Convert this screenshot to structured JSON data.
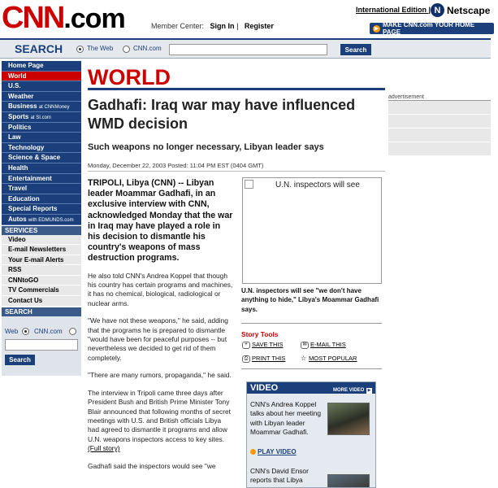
{
  "header": {
    "logo_main": "CNN",
    "logo_suffix": ".com",
    "member_label": "Member Center:",
    "sign_in": "Sign In",
    "sep": "|",
    "register": "Register",
    "international": "International Edition",
    "intl_sep": "|",
    "netscape": "Netscape",
    "netscape_icon": "N",
    "make_home": "MAKE CNN.com YOUR HOME PAGE"
  },
  "searchbar": {
    "title": "SEARCH",
    "option_web": "The Web",
    "option_cnn": "CNN.com",
    "input_value": "",
    "button": "Search"
  },
  "nav": {
    "items": [
      {
        "label": "Home Page",
        "sub": ""
      },
      {
        "label": "World",
        "sub": ""
      },
      {
        "label": "U.S.",
        "sub": ""
      },
      {
        "label": "Weather",
        "sub": ""
      },
      {
        "label": "Business",
        "sub": "at CNNMoney"
      },
      {
        "label": "Sports",
        "sub": "at SI.com"
      },
      {
        "label": "Politics",
        "sub": ""
      },
      {
        "label": "Law",
        "sub": ""
      },
      {
        "label": "Technology",
        "sub": ""
      },
      {
        "label": "Science & Space",
        "sub": ""
      },
      {
        "label": "Health",
        "sub": ""
      },
      {
        "label": "Entertainment",
        "sub": ""
      },
      {
        "label": "Travel",
        "sub": ""
      },
      {
        "label": "Education",
        "sub": ""
      },
      {
        "label": "Special Reports",
        "sub": ""
      },
      {
        "label": "Autos",
        "sub": "with EDMUNDS.com"
      }
    ],
    "services_title": "SERVICES",
    "services": [
      "Video",
      "E-mail Newsletters",
      "Your E-mail Alerts",
      "RSS",
      "CNNtoGO",
      "TV Commercials",
      "Contact Us"
    ],
    "search_title": "SEARCH",
    "search_web": "Web",
    "search_cnn": "CNN.com",
    "search_button": "Search"
  },
  "article": {
    "section": "WORLD",
    "headline": "Gadhafi: Iraq war may have influenced WMD decision",
    "subhead": "Such weapons no longer necessary, Libyan leader says",
    "dateline": "Monday, December 22, 2003 Posted: 11:04 PM EST (0404 GMT)",
    "lede": "TRIPOLI, Libya (CNN) -- Libyan leader Moammar Gadhafi, in an exclusive interview with CNN, acknowledged Monday that the war in Iraq may have played a role in his decision to dismantle his country's weapons of mass destruction programs.",
    "p1": "He also told CNN's Andrea Koppel that though his country has certain programs and machines, it has no chemical, biological, radiological or nuclear arms.",
    "p2": "\"We have not these weapons,\" he said, adding that the programs he is prepared to dismantle \"would have been for peaceful purposes -- but nevertheless we decided to get rid of them completely.",
    "p3": "\"There are many rumors, propaganda,\" he said.",
    "p4": "The interview in Tripoli came three days after President Bush and British Prime Minister Tony Blair announced that following months of secret meetings with U.S. and British officials Libya had agreed to dismantle it programs and allow U.N. weapons inspectors access to key sites.",
    "full_story": "(Full story)",
    "p5": "Gadhafi said the inspectors would see \"we"
  },
  "photo": {
    "alt": "U.N. inspectors will see",
    "caption": "U.N. inspectors will see \"we don't have anything to hide,\" Libya's Moammar Gadhafi says."
  },
  "tools": {
    "title": "Story Tools",
    "save": "SAVE THIS",
    "email": "E-MAIL THIS",
    "print": "PRINT THIS",
    "popular": "MOST POPULAR"
  },
  "video": {
    "title": "VIDEO",
    "more": "MORE VIDEO",
    "item1": "CNN's Andrea Koppel talks about her meeting with Libyan leader Moammar Gadhafi.",
    "play": "PLAY VIDEO",
    "item2": "CNN's David Ensor reports that Libya"
  },
  "ad": {
    "label": "advertisement"
  }
}
